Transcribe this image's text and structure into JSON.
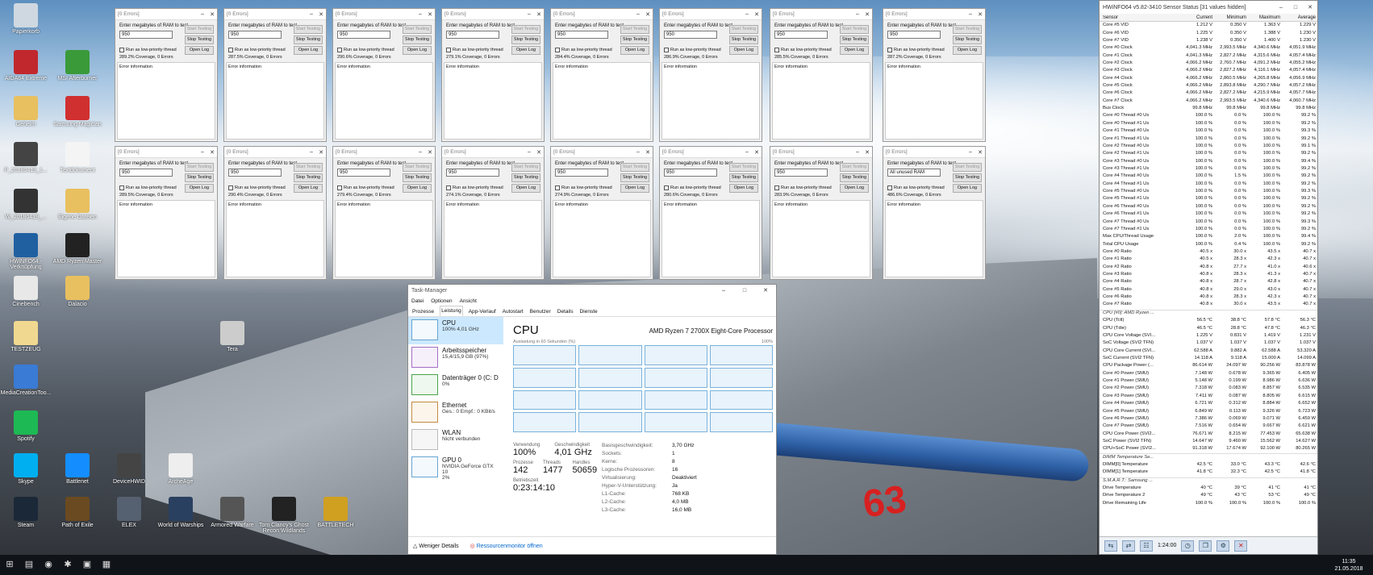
{
  "memtest": {
    "title": "[0 Errors]",
    "prompt": "Enter megabytes of RAM to test",
    "start_label": "Start Testing",
    "stop_label": "Stop Testing",
    "open_log_label": "Open Log",
    "low_priority_label": "Run as low-priority thread",
    "error_info_label": "Error information",
    "windows": [
      {
        "value": "950",
        "coverage": "289.2% Coverage, 0 Errors"
      },
      {
        "value": "950",
        "coverage": "287.5% Coverage, 0 Errors"
      },
      {
        "value": "950",
        "coverage": "290.6% Coverage, 0 Errors"
      },
      {
        "value": "950",
        "coverage": "279.1% Coverage, 0 Errors"
      },
      {
        "value": "950",
        "coverage": "284.4% Coverage, 0 Errors"
      },
      {
        "value": "950",
        "coverage": "286.9% Coverage, 0 Errors"
      },
      {
        "value": "950",
        "coverage": "285.5% Coverage, 0 Errors"
      },
      {
        "value": "950",
        "coverage": "287.2% Coverage, 0 Errors"
      },
      {
        "value": "950",
        "coverage": "289.5% Coverage, 0 Errors"
      },
      {
        "value": "950",
        "coverage": "290.4% Coverage, 0 Errors"
      },
      {
        "value": "950",
        "coverage": "279.4% Coverage, 0 Errors"
      },
      {
        "value": "950",
        "coverage": "274.1% Coverage, 0 Errors"
      },
      {
        "value": "950",
        "coverage": "274.9% Coverage, 0 Errors"
      },
      {
        "value": "950",
        "coverage": "280.6% Coverage, 0 Errors"
      },
      {
        "value": "950",
        "coverage": "283.9% Coverage, 0 Errors"
      },
      {
        "value": "All unused RAM",
        "coverage": "486.6% Coverage, 0 Errors"
      }
    ]
  },
  "desktop_icons": [
    {
      "label": "Papierkorb",
      "icon": "recycle-bin-icon",
      "color": "#cfd8e0"
    },
    {
      "label": "AIDA64 Extreme",
      "icon": "aida64-icon",
      "color": "#c0282d"
    },
    {
      "label": "Geheim",
      "icon": "folder-icon",
      "color": "#e8c060"
    },
    {
      "label": "P_20180419_1...",
      "icon": "photo-icon",
      "color": "#444444"
    },
    {
      "label": "W_20180419_...",
      "icon": "photo-icon",
      "color": "#333333"
    },
    {
      "label": "HWiNFO64 - Verknüpfung",
      "icon": "hwinfo-icon",
      "color": "#2060a0"
    },
    {
      "label": "Cinebench",
      "icon": "cinebench-icon",
      "color": "#e8e8e8"
    },
    {
      "label": "TESTZEUG",
      "icon": "folder-icon",
      "color": "#f0d890"
    },
    {
      "label": "MediaCreationToo...",
      "icon": "media-creation-icon",
      "color": "#3a7bd5"
    },
    {
      "label": "Spotify",
      "icon": "spotify-icon",
      "color": "#1db954"
    },
    {
      "label": "Skype",
      "icon": "skype-icon",
      "color": "#00aff0"
    },
    {
      "label": "Steam",
      "icon": "steam-icon",
      "color": "#1b2838"
    },
    {
      "label": "MSI Afterburner",
      "icon": "afterburner-icon",
      "color": "#3a9a3a"
    },
    {
      "label": "Samsung Magician",
      "icon": "magician-icon",
      "color": "#d03030"
    },
    {
      "label": "Textdokument",
      "icon": "text-file-icon",
      "color": "#f4f4f4"
    },
    {
      "label": "Eigene Dateien",
      "icon": "folder-icon",
      "color": "#e8c060"
    },
    {
      "label": "AMD Ryzen Master",
      "icon": "ryzen-master-icon",
      "color": "#222222"
    },
    {
      "label": "Dalacio",
      "icon": "folder-icon",
      "color": "#e8c060"
    },
    {
      "label": "Path of Exile",
      "icon": "poe-icon",
      "color": "#6a4a20"
    },
    {
      "label": "ELEX",
      "icon": "elex-icon",
      "color": "#556070"
    },
    {
      "label": "World of Warships",
      "icon": "wows-icon",
      "color": "#2a4060"
    },
    {
      "label": "Armored Warfare",
      "icon": "armored-warfare-icon",
      "color": "#555555"
    },
    {
      "label": "Tom Clancy's Ghost Recon Wildlands",
      "icon": "ghost-recon-icon",
      "color": "#222222"
    },
    {
      "label": "BATTLETECH",
      "icon": "battletech-icon",
      "color": "#d0a020"
    },
    {
      "label": "Tera",
      "icon": "tera-icon",
      "color": "#cccccc"
    },
    {
      "label": "Battlenet",
      "icon": "battlenet-icon",
      "color": "#148eff"
    },
    {
      "label": "DeviceHWID",
      "icon": "app-icon",
      "color": "#444444"
    },
    {
      "label": "ArcheAge",
      "icon": "archeage-icon",
      "color": "#eeeeee"
    }
  ],
  "taskmanager": {
    "title": "Task-Manager",
    "menu": [
      "Datei",
      "Optionen",
      "Ansicht"
    ],
    "tabs": [
      "Prozesse",
      "Leistung",
      "App-Verlauf",
      "Autostart",
      "Benutzer",
      "Details",
      "Dienste"
    ],
    "resources": [
      {
        "name": "CPU",
        "sub": "100%  4,01 GHz"
      },
      {
        "name": "Arbeitsspeicher",
        "sub": "15,4/15,9 GB (97%)"
      },
      {
        "name": "Datenträger 0 (C: D",
        "sub": "0%"
      },
      {
        "name": "Ethernet",
        "sub": "Ges.: 0 Empf.: 0 KBit/s"
      },
      {
        "name": "WLAN",
        "sub": "Nicht verbunden"
      },
      {
        "name": "GPU 0",
        "sub": "NVIDIA GeForce GTX 10",
        "sub2": "2%"
      }
    ],
    "heading": "CPU",
    "processor": "AMD Ryzen 7 2700X Eight-Core Processor",
    "graph_label": "Auslastung in 60 Sekunden (%)",
    "graph_max": "100%",
    "usage_label": "Verwendung",
    "usage": "100%",
    "speed_label": "Geschwindigkeit",
    "speed": "4,01 GHz",
    "processes_label": "Prozesse",
    "processes": "142",
    "threads_label": "Threads",
    "threads": "1477",
    "handles_label": "Handles",
    "handles": "50659",
    "uptime_label": "Betriebszeit",
    "uptime": "0:23:14:10",
    "specs": [
      {
        "k": "Basisgeschwindigkeit:",
        "v": "3,70 GHz"
      },
      {
        "k": "Sockets:",
        "v": "1"
      },
      {
        "k": "Kerne:",
        "v": "8"
      },
      {
        "k": "Logische Prozessoren:",
        "v": "16"
      },
      {
        "k": "Virtualisierung:",
        "v": "Deaktiviert"
      },
      {
        "k": "Hyper-V-Unterstützung:",
        "v": "Ja"
      },
      {
        "k": "L1-Cache:",
        "v": "768 KB"
      },
      {
        "k": "L2-Cache:",
        "v": "4,0 MB"
      },
      {
        "k": "L3-Cache:",
        "v": "16,0 MB"
      }
    ],
    "fewer_details": "Weniger Details",
    "resource_monitor": "Ressourcenmonitor öffnen"
  },
  "hwinfo": {
    "title": "HWiNFO64 v5.82-3410 Sensor Status [31 values hidden]",
    "headers": [
      "Sensor",
      "Current",
      "Minimum",
      "Maximum",
      "Average"
    ],
    "rows": [
      [
        "Core #5 VID",
        "1.212 V",
        "0.350 V",
        "1.363 V",
        "1.229 V"
      ],
      [
        "Core #6 VID",
        "1.225 V",
        "0.350 V",
        "1.388 V",
        "1.230 V"
      ],
      [
        "Core #7 VID",
        "1.238 V",
        "0.350 V",
        "1.400 V",
        "1.230 V"
      ],
      [
        "Core #0 Clock",
        "4,041.3 MHz",
        "2,993.5 MHz",
        "4,340.6 MHz",
        "4,051.9 MHz"
      ],
      [
        "Core #1 Clock",
        "4,041.3 MHz",
        "2,827.2 MHz",
        "4,315.6 MHz",
        "4,057.4 MHz"
      ],
      [
        "Core #2 Clock",
        "4,066.2 MHz",
        "2,760.7 MHz",
        "4,091.2 MHz",
        "4,055.2 MHz"
      ],
      [
        "Core #3 Clock",
        "4,066.2 MHz",
        "2,827.2 MHz",
        "4,116.1 MHz",
        "4,057.4 MHz"
      ],
      [
        "Core #4 Clock",
        "4,066.2 MHz",
        "2,860.5 MHz",
        "4,265.8 MHz",
        "4,056.9 MHz"
      ],
      [
        "Core #5 Clock",
        "4,066.2 MHz",
        "2,893.8 MHz",
        "4,290.7 MHz",
        "4,057.2 MHz"
      ],
      [
        "Core #6 Clock",
        "4,066.2 MHz",
        "2,827.2 MHz",
        "4,215.9 MHz",
        "4,057.7 MHz"
      ],
      [
        "Core #7 Clock",
        "4,066.2 MHz",
        "2,993.5 MHz",
        "4,340.6 MHz",
        "4,060.7 MHz"
      ],
      [
        "Bus Clock",
        "99.8 MHz",
        "99.8 MHz",
        "99.8 MHz",
        "99.8 MHz"
      ],
      [
        "Core #0 Thread #0 Us",
        "100.0 %",
        "0.0 %",
        "100.0 %",
        "99.2 %"
      ],
      [
        "Core #0 Thread #1 Us",
        "100.0 %",
        "0.0 %",
        "100.0 %",
        "99.2 %"
      ],
      [
        "Core #1 Thread #0 Us",
        "100.0 %",
        "0.0 %",
        "100.0 %",
        "99.3 %"
      ],
      [
        "Core #1 Thread #1 Us",
        "100.0 %",
        "0.0 %",
        "100.0 %",
        "99.2 %"
      ],
      [
        "Core #2 Thread #0 Us",
        "100.0 %",
        "0.0 %",
        "100.0 %",
        "99.1 %"
      ],
      [
        "Core #2 Thread #1 Us",
        "100.0 %",
        "0.0 %",
        "100.0 %",
        "99.2 %"
      ],
      [
        "Core #3 Thread #0 Us",
        "100.0 %",
        "0.0 %",
        "100.0 %",
        "99.4 %"
      ],
      [
        "Core #3 Thread #1 Us",
        "100.0 %",
        "0.0 %",
        "100.0 %",
        "99.2 %"
      ],
      [
        "Core #4 Thread #0 Us",
        "100.0 %",
        "1.5 %",
        "100.0 %",
        "99.2 %"
      ],
      [
        "Core #4 Thread #1 Us",
        "100.0 %",
        "0.0 %",
        "100.0 %",
        "99.2 %"
      ],
      [
        "Core #5 Thread #0 Us",
        "100.0 %",
        "0.0 %",
        "100.0 %",
        "99.3 %"
      ],
      [
        "Core #5 Thread #1 Us",
        "100.0 %",
        "0.0 %",
        "100.0 %",
        "99.2 %"
      ],
      [
        "Core #6 Thread #0 Us",
        "100.0 %",
        "0.0 %",
        "100.0 %",
        "99.2 %"
      ],
      [
        "Core #6 Thread #1 Us",
        "100.0 %",
        "0.0 %",
        "100.0 %",
        "99.2 %"
      ],
      [
        "Core #7 Thread #0 Us",
        "100.0 %",
        "0.0 %",
        "100.0 %",
        "99.3 %"
      ],
      [
        "Core #7 Thread #1 Us",
        "100.0 %",
        "0.0 %",
        "100.0 %",
        "99.2 %"
      ],
      [
        "Max CPU/Thread Usage",
        "100.0 %",
        "2.0 %",
        "100.0 %",
        "99.4 %"
      ],
      [
        "Total CPU Usage",
        "100.0 %",
        "0.4 %",
        "100.0 %",
        "99.2 %"
      ],
      [
        "Core #0 Ratio",
        "40.5 x",
        "30.0 x",
        "43.5 x",
        "40.7 x"
      ],
      [
        "Core #1 Ratio",
        "40.5 x",
        "28.3 x",
        "42.3 x",
        "40.7 x"
      ],
      [
        "Core #2 Ratio",
        "40.8 x",
        "27.7 x",
        "41.0 x",
        "40.6 x"
      ],
      [
        "Core #3 Ratio",
        "40.8 x",
        "28.3 x",
        "41.3 x",
        "40.7 x"
      ],
      [
        "Core #4 Ratio",
        "40.8 x",
        "28.7 x",
        "42.8 x",
        "40.7 x"
      ],
      [
        "Core #5 Ratio",
        "40.8 x",
        "29.0 x",
        "43.0 x",
        "40.7 x"
      ],
      [
        "Core #6 Ratio",
        "40.8 x",
        "28.3 x",
        "42.3 x",
        "40.7 x"
      ],
      [
        "Core #7 Ratio",
        "40.8 x",
        "30.0 x",
        "43.5 x",
        "40.7 x"
      ],
      [
        "CPU [#0]: AMD Ryzen ...",
        "",
        "",
        "",
        "",
        "g"
      ],
      [
        "CPU (Tctl)",
        "56.5 °C",
        "38.8 °C",
        "57.8 °C",
        "56.3 °C"
      ],
      [
        "CPU (Tdie)",
        "46.5 °C",
        "28.8 °C",
        "47.8 °C",
        "46.3 °C"
      ],
      [
        "CPU Core Voltage (SVI...",
        "1.225 V",
        "0.831 V",
        "1.419 V",
        "1.231 V"
      ],
      [
        "SoC Voltage (SVI2 TFN)",
        "1.037 V",
        "1.037 V",
        "1.037 V",
        "1.037 V"
      ],
      [
        "CPU Core Current (SVI...",
        "62.588 A",
        "9.882 A",
        "62.588 A",
        "53.320 A"
      ],
      [
        "SoC Current (SVI2 TFN)",
        "14.118 A",
        "9.118 A",
        "15.000 A",
        "14.099 A"
      ],
      [
        "CPU Package Power (...",
        "86.614 W",
        "24.097 W",
        "90.256 W",
        "83.878 W"
      ],
      [
        "Core #0 Power (SMU)",
        "7.148 W",
        "0.678 W",
        "9.365 W",
        "6.405 W"
      ],
      [
        "Core #1 Power (SMU)",
        "5.148 W",
        "0.199 W",
        "8.986 W",
        "6.636 W"
      ],
      [
        "Core #2 Power (SMU)",
        "7.318 W",
        "0.083 W",
        "8.857 W",
        "6.535 W"
      ],
      [
        "Core #3 Power (SMU)",
        "7.411 W",
        "0.087 W",
        "8.805 W",
        "6.615 W"
      ],
      [
        "Core #4 Power (SMU)",
        "6.721 W",
        "0.312 W",
        "8.884 W",
        "6.652 W"
      ],
      [
        "Core #5 Power (SMU)",
        "6.849 W",
        "0.113 W",
        "9.326 W",
        "6.723 W"
      ],
      [
        "Core #6 Power (SMU)",
        "7.386 W",
        "0.069 W",
        "9.071 W",
        "6.459 W"
      ],
      [
        "Core #7 Power (SMU)",
        "7.516 W",
        "0.654 W",
        "9.667 W",
        "6.621 W"
      ],
      [
        "CPU Core Power (SVI2...",
        "76.671 W",
        "8.215 W",
        "77.453 W",
        "65.638 W"
      ],
      [
        "SoC Power (SVI2 TFN)",
        "14.647 W",
        "9.460 W",
        "15.562 W",
        "14.627 W"
      ],
      [
        "CPU+SoC Power (SVI2...",
        "91.318 W",
        "17.674 W",
        "92.100 W",
        "80.265 W"
      ],
      [
        "DIMM Temperature Se...",
        "",
        "",
        "",
        "",
        "g"
      ],
      [
        "DIMM[0] Temperature",
        "42.5 °C",
        "33.0 °C",
        "43.3 °C",
        "42.6 °C"
      ],
      [
        "DIMM[1] Temperature",
        "41.8 °C",
        "32.3 °C",
        "42.5 °C",
        "41.8 °C"
      ],
      [
        "S.M.A.R.T.: Samsung ...",
        "",
        "",
        "",
        "",
        "g"
      ],
      [
        "Drive Temperature",
        "40 °C",
        "39 °C",
        "41 °C",
        "41 °C"
      ],
      [
        "Drive Temperature 2",
        "49 °C",
        "43 °C",
        "53 °C",
        "49 °C"
      ],
      [
        "Drive Remaining Life",
        "100.0 %",
        "100.0 %",
        "100.0 %",
        "100.0 %"
      ]
    ],
    "timer": "1:24:00"
  },
  "taskbar": {
    "time": "11:35",
    "date": "21.05.2018"
  }
}
